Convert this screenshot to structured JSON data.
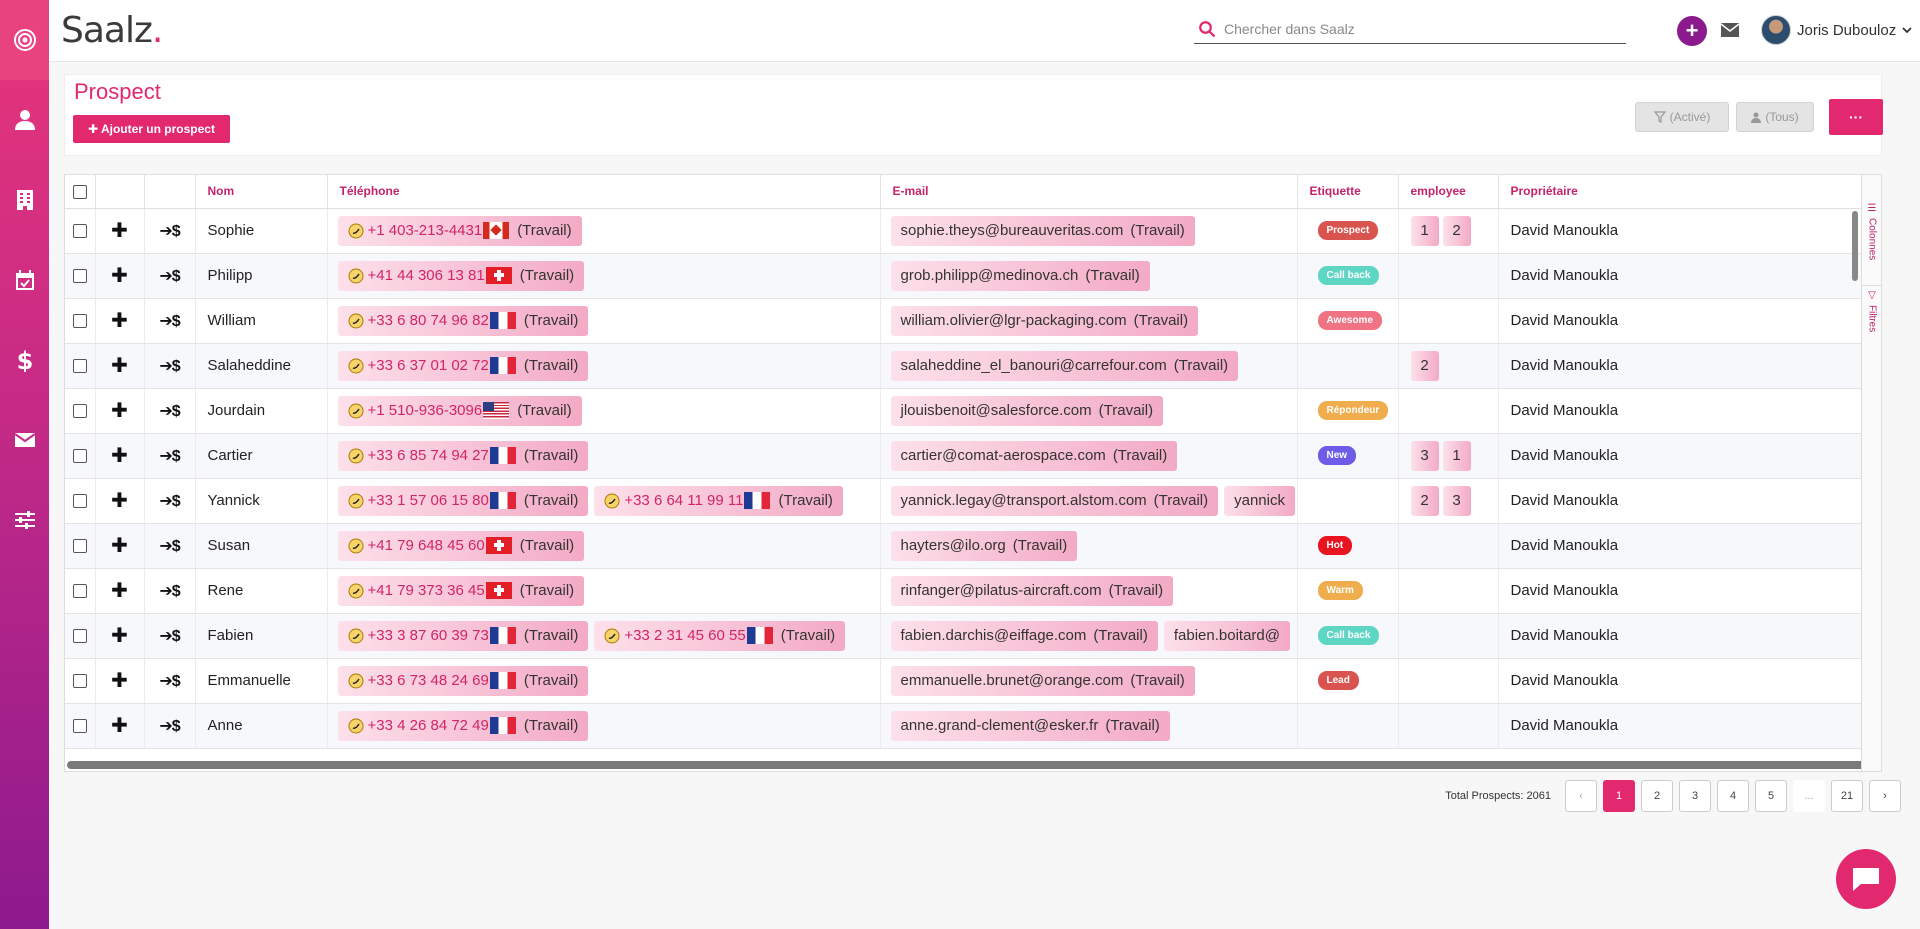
{
  "app": {
    "logo_text": "Saalz",
    "logo_dot": "."
  },
  "topbar": {
    "search_placeholder": "Chercher dans Saalz",
    "user_name": "Joris Dubouloz",
    "plus_label": "+"
  },
  "sidebar": {
    "items": [
      {
        "icon": "target-icon"
      },
      {
        "icon": "user-icon"
      },
      {
        "icon": "building-icon"
      },
      {
        "icon": "calendar-check-icon"
      },
      {
        "icon": "dollar-icon"
      },
      {
        "icon": "envelope-icon"
      },
      {
        "icon": "sliders-icon"
      }
    ]
  },
  "header": {
    "title": "Prospect",
    "add_button": "✚ Ajouter un prospect",
    "filter_active": "(Activé)",
    "filter_all": "(Tous)",
    "more_button": "···"
  },
  "table": {
    "columns": [
      "Nom",
      "Téléphone",
      "E-mail",
      "Etiquette",
      "employee",
      "Propriétaire"
    ],
    "rows": [
      {
        "name": "Sophie",
        "phones": [
          {
            "num": "+1 403-213-4431",
            "flag": "ca"
          }
        ],
        "emails": [
          "sophie.theys@bureauveritas.com"
        ],
        "tag": {
          "label": "Prospect",
          "color": "#d9534f"
        },
        "emp": [
          "1",
          "2"
        ],
        "owner": "David Manoukla"
      },
      {
        "name": "Philipp",
        "phones": [
          {
            "num": "+41 44 306 13 81",
            "flag": "ch"
          }
        ],
        "emails": [
          "grob.philipp@medinova.ch"
        ],
        "tag": {
          "label": "Call back",
          "color": "#5fd6c4"
        },
        "emp": [],
        "owner": "David Manoukla"
      },
      {
        "name": "William",
        "phones": [
          {
            "num": "+33 6 80 74 96 82",
            "flag": "fr"
          }
        ],
        "emails": [
          "william.olivier@lgr-packaging.com"
        ],
        "tag": {
          "label": "Awesome",
          "color": "#f07383"
        },
        "emp": [],
        "owner": "David Manoukla"
      },
      {
        "name": "Salaheddine",
        "phones": [
          {
            "num": "+33 6 37 01 02 72",
            "flag": "fr"
          }
        ],
        "emails": [
          "salaheddine_el_banouri@carrefour.com"
        ],
        "tag": null,
        "emp": [
          "2"
        ],
        "owner": "David Manoukla"
      },
      {
        "name": "Jourdain",
        "phones": [
          {
            "num": "+1 510-936-3096",
            "flag": "us"
          }
        ],
        "emails": [
          "jlouisbenoit@salesforce.com"
        ],
        "tag": {
          "label": "Répondeur",
          "color": "#f0ad4e"
        },
        "emp": [],
        "owner": "David Manoukla"
      },
      {
        "name": "Cartier",
        "phones": [
          {
            "num": "+33 6 85 74 94 27",
            "flag": "fr"
          }
        ],
        "emails": [
          "cartier@comat-aerospace.com"
        ],
        "tag": {
          "label": "New",
          "color": "#6c5ce7"
        },
        "emp": [
          "3",
          "1"
        ],
        "owner": "David Manoukla"
      },
      {
        "name": "Yannick",
        "phones": [
          {
            "num": "+33 1 57 06 15 80",
            "flag": "fr"
          },
          {
            "num": "+33 6 64 11 99 11",
            "flag": "fr"
          }
        ],
        "emails": [
          "yannick.legay@transport.alstom.com",
          "yannick"
        ],
        "tag": null,
        "emp": [
          "2",
          "3"
        ],
        "owner": "David Manoukla"
      },
      {
        "name": "Susan",
        "phones": [
          {
            "num": "+41 79 648 45 60",
            "flag": "ch"
          }
        ],
        "emails": [
          "hayters@ilo.org"
        ],
        "tag": {
          "label": "Hot",
          "color": "#e8141f"
        },
        "emp": [],
        "owner": "David Manoukla"
      },
      {
        "name": "Rene",
        "phones": [
          {
            "num": "+41 79 373 36 45",
            "flag": "ch"
          }
        ],
        "emails": [
          "rinfanger@pilatus-aircraft.com"
        ],
        "tag": {
          "label": "Warm",
          "color": "#f0ad4e"
        },
        "emp": [],
        "owner": "David Manoukla"
      },
      {
        "name": "Fabien",
        "phones": [
          {
            "num": "+33 3 87 60 39 73",
            "flag": "fr"
          },
          {
            "num": "+33 2 31 45 60 55",
            "flag": "fr"
          }
        ],
        "emails": [
          "fabien.darchis@eiffage.com",
          "fabien.boitard@"
        ],
        "tag": {
          "label": "Call back",
          "color": "#5fd6c4"
        },
        "emp": [],
        "owner": "David Manoukla"
      },
      {
        "name": "Emmanuelle",
        "phones": [
          {
            "num": "+33 6 73 48 24 69",
            "flag": "fr"
          }
        ],
        "emails": [
          "emmanuelle.brunet@orange.com"
        ],
        "tag": {
          "label": "Lead",
          "color": "#d9534f"
        },
        "emp": [],
        "owner": "David Manoukla"
      },
      {
        "name": "Anne",
        "phones": [
          {
            "num": "+33 4 26 84 72 49",
            "flag": "fr"
          }
        ],
        "emails": [
          "anne.grand-clement@esker.fr"
        ],
        "tag": null,
        "emp": [],
        "owner": "David Manoukla"
      }
    ],
    "work_label": "(Travail)"
  },
  "rail": {
    "columns_label": "Colonnes",
    "filters_label": "Filtres"
  },
  "pagination": {
    "total": "Total Prospects: 2061",
    "prev": "‹",
    "next": "›",
    "pages": [
      "1",
      "2",
      "3",
      "4",
      "5",
      "...",
      "21"
    ],
    "active": "1"
  }
}
